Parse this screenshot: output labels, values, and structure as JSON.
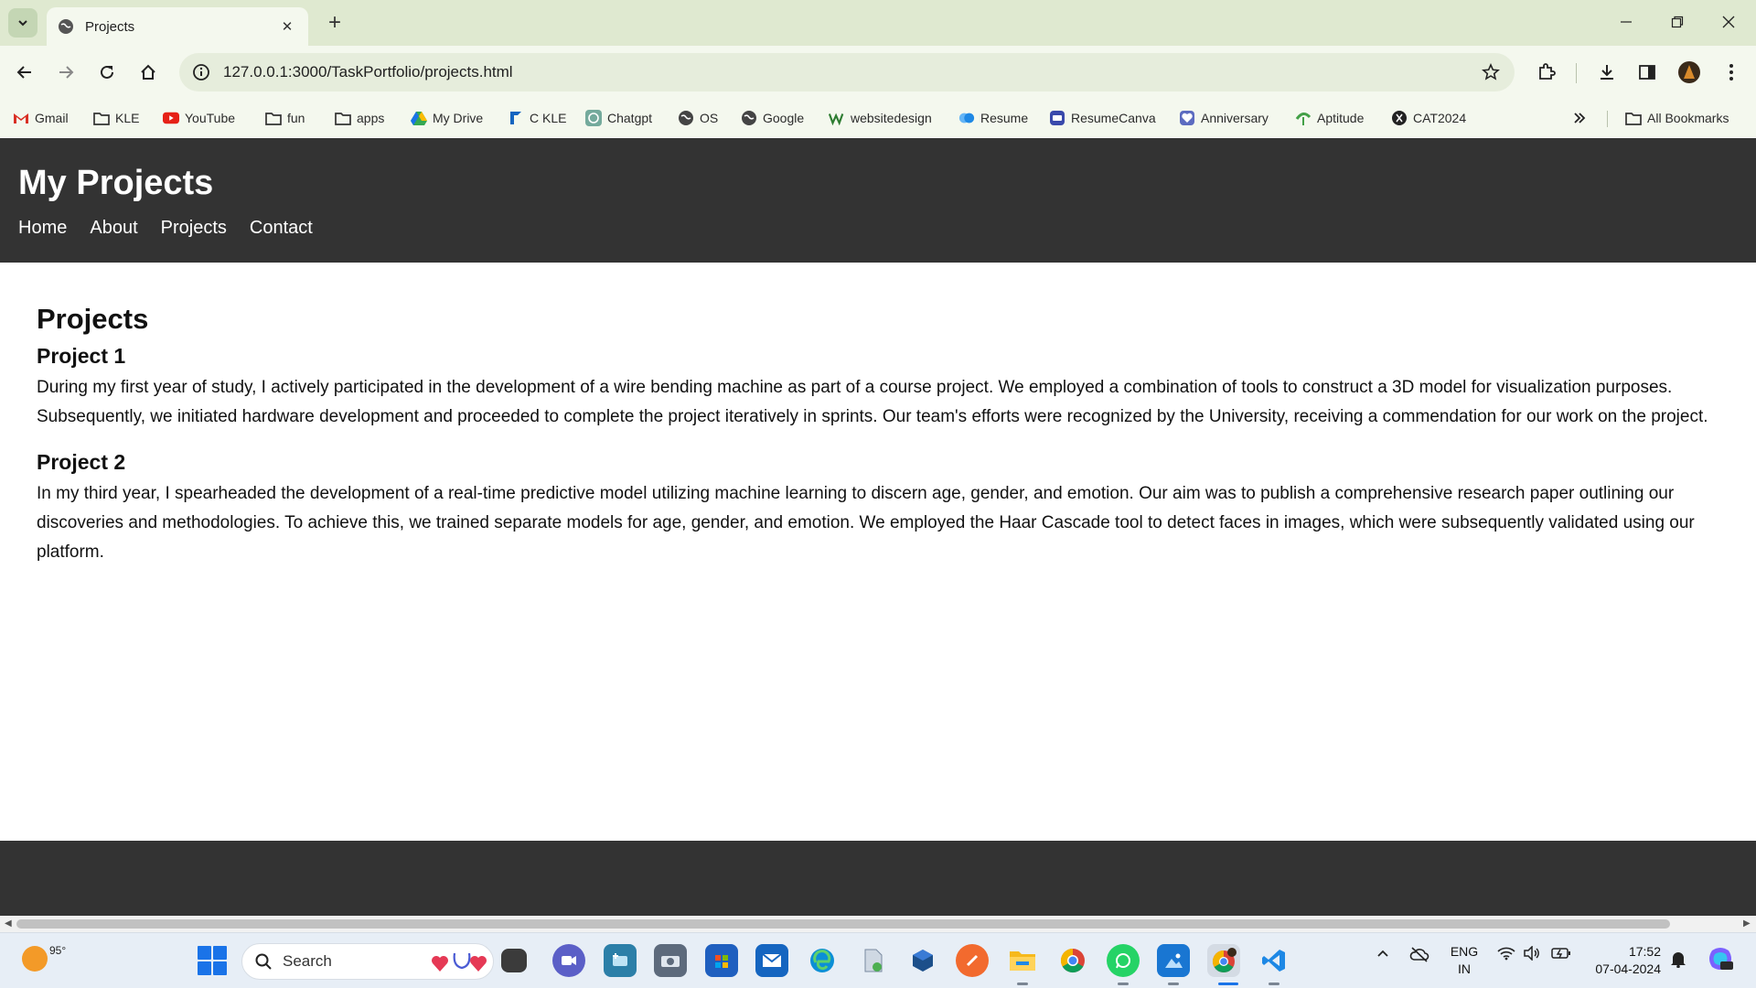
{
  "browser": {
    "tab_title": "Projects",
    "url": "127.0.0.1:3000/TaskPortfolio/projects.html",
    "bookmarks": [
      {
        "label": "Gmail",
        "icon": "gmail-icon"
      },
      {
        "label": "KLE",
        "icon": "folder-icon"
      },
      {
        "label": "YouTube",
        "icon": "youtube-icon"
      },
      {
        "label": "fun",
        "icon": "folder-icon"
      },
      {
        "label": "apps",
        "icon": "folder-icon"
      },
      {
        "label": "My Drive",
        "icon": "drive-icon"
      },
      {
        "label": "C KLE",
        "icon": "bookmark-site-icon"
      },
      {
        "label": "Chatgpt",
        "icon": "chatgpt-icon"
      },
      {
        "label": "OS",
        "icon": "globe-icon"
      },
      {
        "label": "Google",
        "icon": "globe-icon"
      },
      {
        "label": "websitedesign",
        "icon": "w-icon"
      },
      {
        "label": "Resume",
        "icon": "resume-icon"
      },
      {
        "label": "ResumeCanva",
        "icon": "canva-icon"
      },
      {
        "label": "Anniversary",
        "icon": "anniversary-icon"
      },
      {
        "label": "Aptitude",
        "icon": "aptitude-icon"
      },
      {
        "label": "CAT2024",
        "icon": "cat-icon"
      }
    ],
    "all_bookmarks_label": "All Bookmarks"
  },
  "site": {
    "title": "My Projects",
    "nav": [
      "Home",
      "About",
      "Projects",
      "Contact"
    ]
  },
  "main": {
    "heading": "Projects",
    "projects": [
      {
        "title": "Project 1",
        "description": "During my first year of study, I actively participated in the development of a wire bending machine as part of a course project. We employed a combination of tools to construct a 3D model for visualization purposes. Subsequently, we initiated hardware development and proceeded to complete the project iteratively in sprints. Our team's efforts were recognized by the University, receiving a commendation for our work on the project."
      },
      {
        "title": "Project 2",
        "description": "In my third year, I spearheaded the development of a real-time predictive model utilizing machine learning to discern age, gender, and emotion. Our aim was to publish a comprehensive research paper outlining our discoveries and methodologies. To achieve this, we trained separate models for age, gender, and emotion. We employed the Haar Cascade tool to detect faces in images, which were subsequently validated using our platform."
      }
    ]
  },
  "taskbar": {
    "temperature": "95°",
    "search_placeholder": "Search",
    "lang_line1": "ENG",
    "lang_line2": "IN",
    "time": "17:52",
    "date": "07-04-2024"
  },
  "colors": {
    "header_bg": "#333333",
    "footer_bg": "#333333",
    "browser_frame": "#dfe9d0"
  }
}
